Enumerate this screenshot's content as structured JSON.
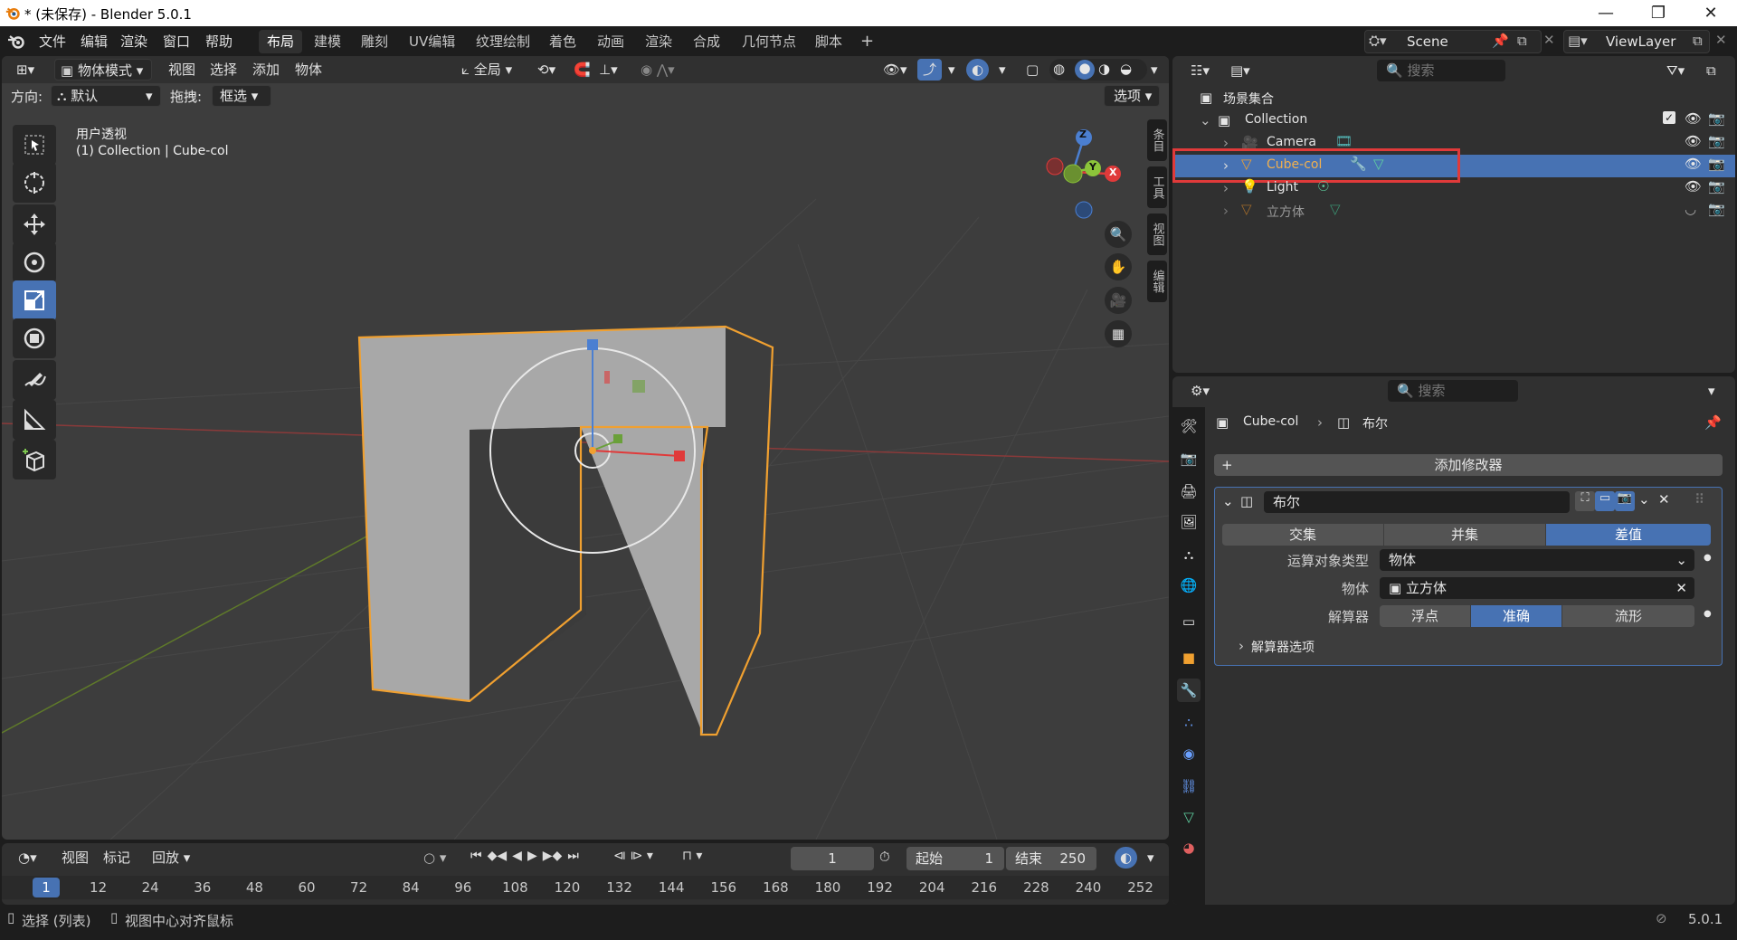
{
  "window": {
    "title": "* (未保存) - Blender 5.0.1"
  },
  "menubar": {
    "menus": [
      "文件",
      "编辑",
      "渲染",
      "窗口",
      "帮助"
    ],
    "workspaces": [
      "布局",
      "建模",
      "雕刻",
      "UV编辑",
      "纹理绘制",
      "着色",
      "动画",
      "渲染",
      "合成",
      "几何节点",
      "脚本"
    ],
    "active_workspace": "布局",
    "scene": "Scene",
    "view_layer": "ViewLayer"
  },
  "viewport": {
    "mode": "物体模式",
    "menus": [
      "视图",
      "选择",
      "添加",
      "物体"
    ],
    "transform_space": "全局",
    "orientation_label": "方向:",
    "orientation_value": "默认",
    "drag_label": "拖拽:",
    "drag_value": "框选",
    "options_label": "选项",
    "view_name": "用户透视",
    "view_info": "(1) Collection | Cube-col",
    "axis_z": "Z",
    "axis_y": "Y",
    "axis_x": "X",
    "side_tabs": [
      "条目",
      "工具",
      "视图",
      "编辑"
    ]
  },
  "outliner": {
    "search_placeholder": "搜索",
    "scene_collection": "场景集合",
    "collection": "Collection",
    "items": [
      {
        "name": "Camera",
        "selected": false
      },
      {
        "name": "Cube-col",
        "selected": true
      },
      {
        "name": "Light",
        "selected": false
      },
      {
        "name": "立方体",
        "selected": false
      }
    ]
  },
  "properties": {
    "search_placeholder": "搜索",
    "breadcrumb_object": "Cube-col",
    "breadcrumb_modifier": "布尔",
    "add_modifier": "添加修改器",
    "modifier_name": "布尔",
    "operations": [
      "交集",
      "并集",
      "差值"
    ],
    "active_operation": "差值",
    "operand_type_label": "运算对象类型",
    "operand_type_value": "物体",
    "object_label": "物体",
    "object_value": "立方体",
    "solver_label": "解算器",
    "solvers": [
      "浮点",
      "准确",
      "流形"
    ],
    "active_solver": "准确",
    "solver_options": "解算器选项"
  },
  "timeline": {
    "menus": [
      "视图",
      "标记"
    ],
    "playback": "回放",
    "current_frame": "1",
    "start_label": "起始",
    "start_value": "1",
    "end_label": "结束",
    "end_value": "250",
    "ruler": [
      "1",
      "12",
      "24",
      "36",
      "48",
      "60",
      "72",
      "84",
      "96",
      "108",
      "120",
      "132",
      "144",
      "156",
      "168",
      "180",
      "192",
      "204",
      "216",
      "228",
      "240",
      "252"
    ]
  },
  "statusbar": {
    "left_hint": "选择 (列表)",
    "middle_hint": "视图中心对齐鼠标",
    "version": "5.0.1"
  },
  "colors": {
    "accent": "#4772b3",
    "highlight_box": "#e03a3a",
    "selection_outline": "#f0a030"
  }
}
